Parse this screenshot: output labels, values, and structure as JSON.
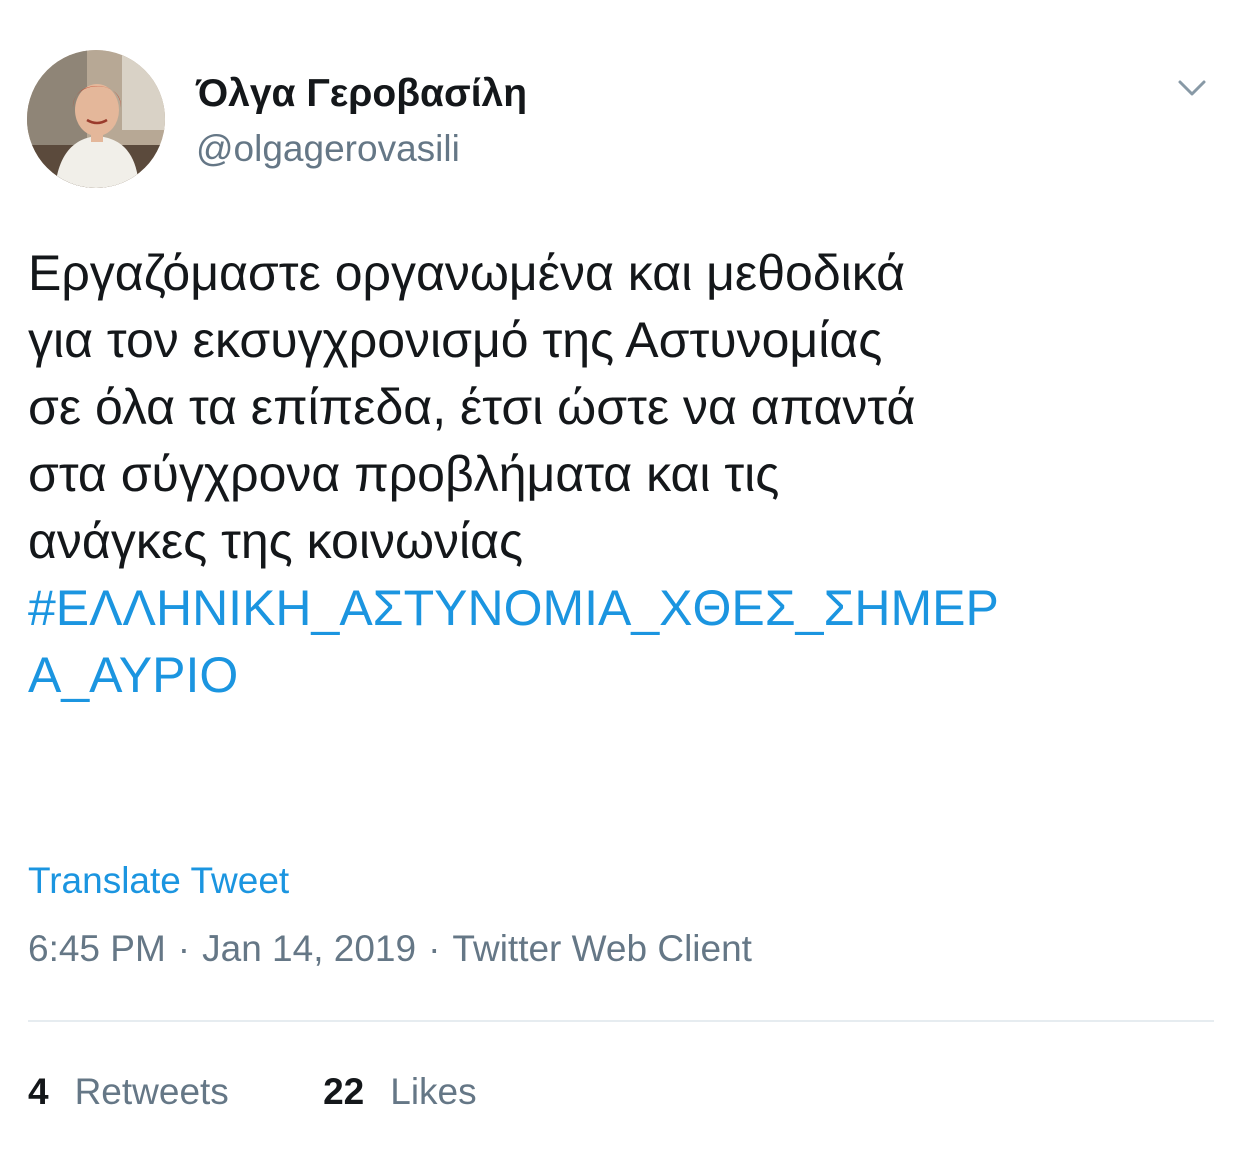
{
  "user": {
    "display_name": "Όλγα Γεροβασίλη",
    "handle": "@olgagerovasili"
  },
  "menu": {
    "icon": "chevron-down-icon"
  },
  "tweet": {
    "text_lines": [
      "Εργαζόμαστε οργανωμένα και μεθοδικά",
      "για τον εκσυγχρονισμό της Αστυνομίας",
      "σε όλα τα επίπεδα, έτσι ώστε να απαντά",
      "στα σύγχρονα προβλήματα και τις",
      "ανάγκες της κοινωνίας"
    ],
    "hashtag_lines": [
      "#ΕΛΛΗΝΙΚΗ_ΑΣΤΥΝΟΜΙΑ_ΧΘΕΣ_ΣΗΜΕΡ",
      "Α_ΑΥΡΙΟ"
    ]
  },
  "translate_label": "Translate Tweet",
  "meta": {
    "time": "6:45 PM",
    "separator": "·",
    "date": "Jan 14, 2019",
    "source": "Twitter Web Client"
  },
  "stats": {
    "retweets_count": "4",
    "retweets_label": "Retweets",
    "likes_count": "22",
    "likes_label": "Likes"
  },
  "colors": {
    "link": "#1b95e0",
    "secondary_text": "#657786",
    "primary_text": "#14171a",
    "divider": "#e6ecf0"
  }
}
